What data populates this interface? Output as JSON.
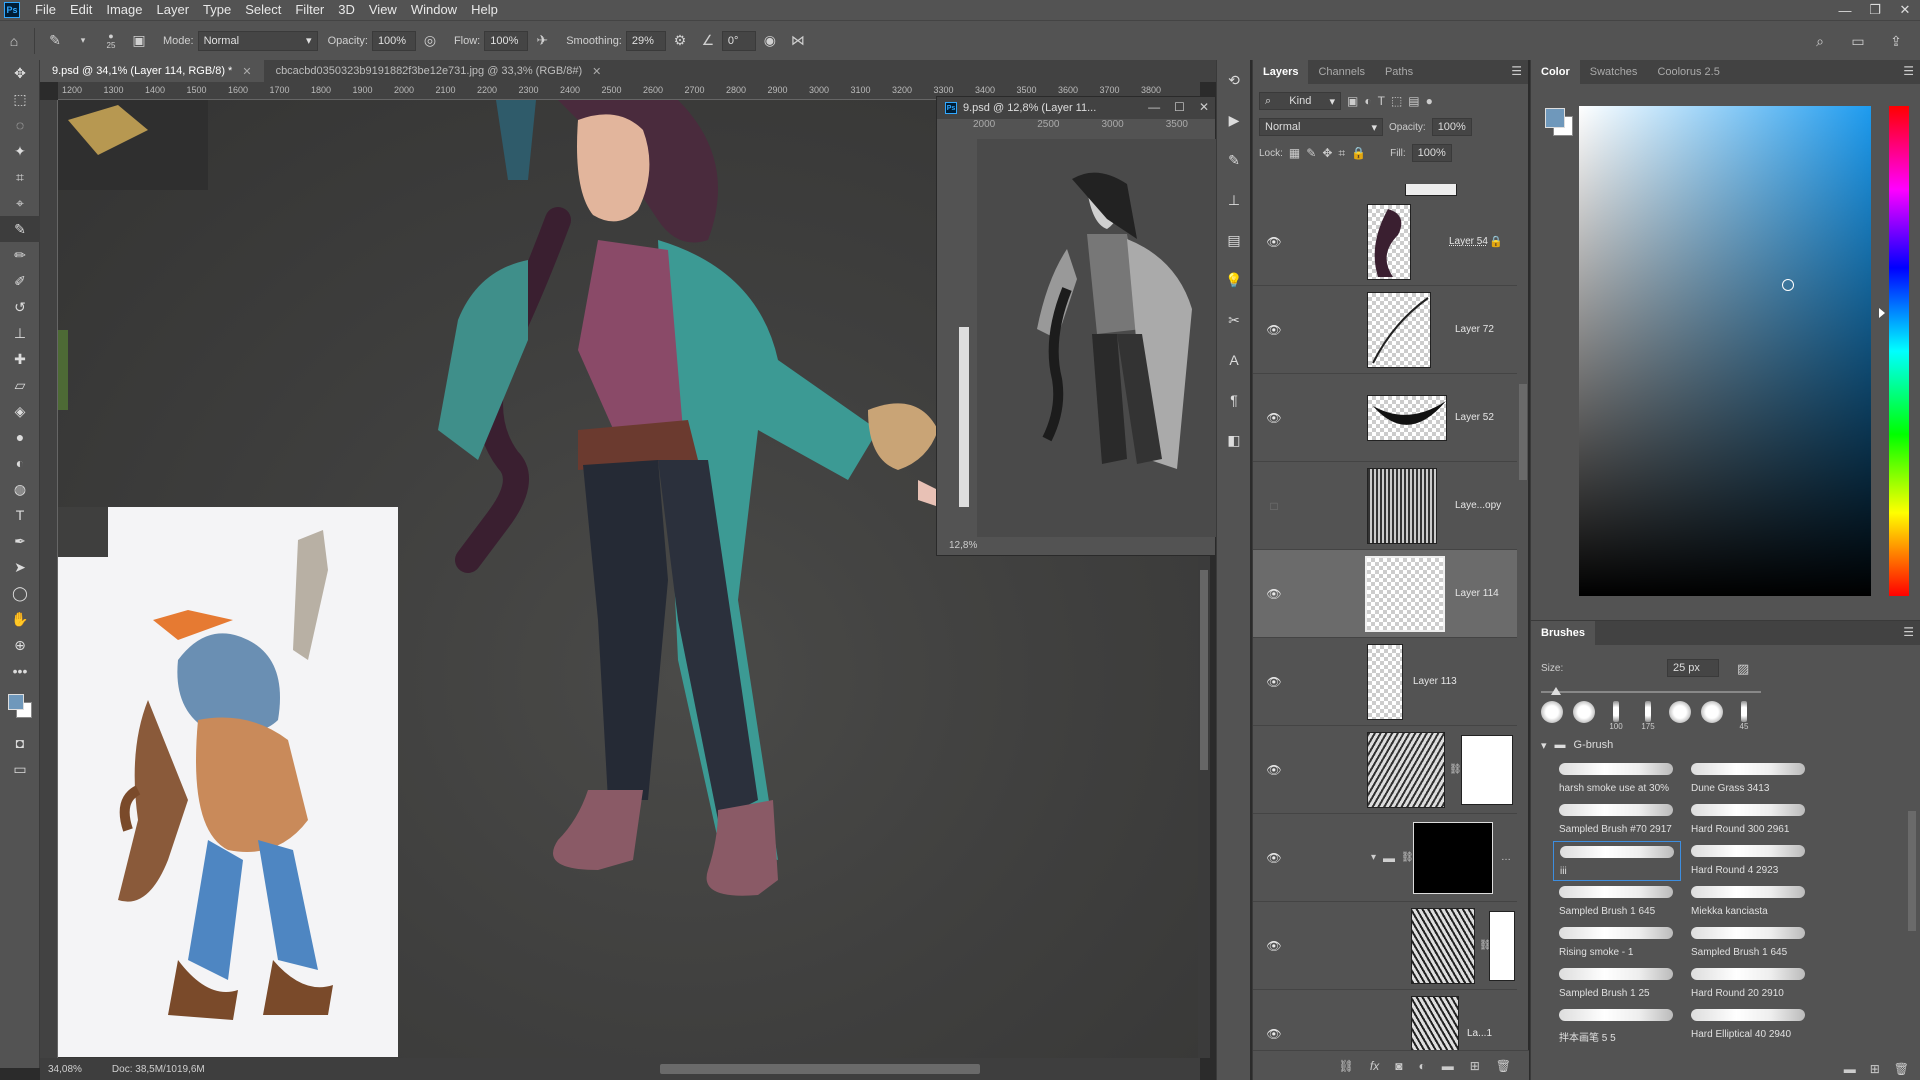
{
  "menu": [
    "File",
    "Edit",
    "Image",
    "Layer",
    "Type",
    "Select",
    "Filter",
    "3D",
    "View",
    "Window",
    "Help"
  ],
  "app_logo": "Ps",
  "options": {
    "brush_size": "25",
    "mode_label": "Mode:",
    "mode_value": "Normal",
    "opacity_label": "Opacity:",
    "opacity_value": "100%",
    "flow_label": "Flow:",
    "flow_value": "100%",
    "smoothing_label": "Smoothing:",
    "smoothing_value": "29%",
    "angle_value": "0°"
  },
  "tabs": [
    {
      "label": "9.psd @ 34,1% (Layer 114, RGB/8) *"
    },
    {
      "label": "cbcacbd0350323b9191882f3be12e731.jpg @ 33,3% (RGB/8#)"
    }
  ],
  "ruler_h": [
    "1200",
    "1300",
    "1400",
    "1500",
    "1600",
    "1700",
    "1800",
    "1900",
    "2000",
    "2100",
    "2200",
    "2300",
    "2400",
    "2500",
    "2600",
    "2700",
    "2800",
    "2900",
    "3000",
    "3100",
    "3200",
    "3300",
    "3400",
    "3500",
    "3600",
    "3700",
    "3800"
  ],
  "status": {
    "zoom": "34,08%",
    "doc": "Doc: 38,5M/1019,6M"
  },
  "navigator": {
    "title": "9.psd @ 12,8% (Layer 11...",
    "zoom": "12,8%",
    "ruler": [
      "2000",
      "2500",
      "3000",
      "3500"
    ]
  },
  "layers_panel": {
    "tabs": [
      "Layers",
      "Channels",
      "Paths"
    ],
    "filter_label": "Kind",
    "blend_mode": "Normal",
    "opacity_label": "Opacity:",
    "opacity_value": "100%",
    "lock_label": "Lock:",
    "fill_label": "Fill:",
    "fill_value": "100%",
    "layers": [
      {
        "name": "Layer 54",
        "visible": true
      },
      {
        "name": "Layer 72",
        "visible": true
      },
      {
        "name": "Layer 52",
        "visible": true
      },
      {
        "name": "Laye...opy",
        "visible": false
      },
      {
        "name": "Layer 114",
        "visible": true
      },
      {
        "name": "Layer 113",
        "visible": true
      },
      {
        "name": "",
        "visible": true
      },
      {
        "name": "",
        "visible": true
      },
      {
        "name": "",
        "visible": true
      },
      {
        "name": "La...1",
        "visible": true
      }
    ]
  },
  "color_panel": {
    "tabs": [
      "Color",
      "Swatches",
      "Coolorus 2.5"
    ],
    "fg": "#6f98bb",
    "bg": "#ffffff"
  },
  "brushes_panel": {
    "title": "Brushes",
    "size_label": "Size:",
    "size_value": "25 px",
    "presets": [
      "",
      "",
      "100",
      "175",
      "",
      "",
      "45"
    ],
    "group_name": "G-brush",
    "brushes": [
      "harsh smoke use at 30%",
      "Dune Grass 3413",
      "Sampled Brush #70 2917",
      "Hard Round 300 2961",
      "iii",
      "Hard Round 4 2923",
      "Sampled Brush 1 645",
      "Miekka kanciasta",
      "Rising smoke - 1",
      "Sampled Brush 1 645",
      "Sampled Brush 1 25",
      "Hard Round 20 2910",
      "拌本画笔 5 5",
      "Hard Elliptical 40 2940"
    ]
  }
}
